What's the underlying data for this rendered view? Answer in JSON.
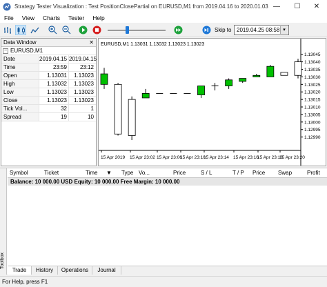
{
  "window": {
    "title": "Strategy Tester Visualization : Test PositionClosePartial on EURUSD,M1 from 2019.04.16 to 2020.01.03",
    "minimize": "—",
    "maximize": "☐",
    "close": "✕"
  },
  "menu": [
    "File",
    "View",
    "Charts",
    "Tester",
    "Help"
  ],
  "toolbar": {
    "skip_label": "Skip to",
    "skip_date": "2019.04.25 08:58",
    "dropdown_arrow": "▾",
    "speed_level": 0.3,
    "icons": [
      "bar-chart-icon",
      "candlestick-icon",
      "line-chart-icon",
      "zoom-in-icon",
      "zoom-out-icon",
      "play-icon",
      "stop-icon",
      "fast-forward-icon",
      "skip-forward-icon"
    ],
    "colors": {
      "play": "#1ea23c",
      "stop": "#d62222",
      "skip": "#1e78d7"
    }
  },
  "data_window": {
    "title": "Data Window",
    "close": "✕",
    "symbol": "EURUSD,M1",
    "expand": "−",
    "rows": [
      {
        "key": "Date",
        "v1": "2019.04.15",
        "v2": "2019.04.15"
      },
      {
        "key": "Time",
        "v1": "23:59",
        "v2": "23:12"
      },
      {
        "key": "Open",
        "v1": "1.13031",
        "v2": "1.13023"
      },
      {
        "key": "High",
        "v1": "1.13032",
        "v2": "1.13023"
      },
      {
        "key": "Low",
        "v1": "1.13023",
        "v2": "1.13023"
      },
      {
        "key": "Close",
        "v1": "1.13023",
        "v2": "1.13023"
      },
      {
        "key": "Tick Vol...",
        "v1": "32",
        "v2": "1"
      },
      {
        "key": "Spread",
        "v1": "19",
        "v2": "10"
      }
    ]
  },
  "chart": {
    "header": "EURUSD,M1  1.13031 1.13032 1.13023 1.13023",
    "colors": {
      "bull": "#00c000",
      "bear": "#ffffff",
      "wick": "#000000"
    },
    "y_ticks": [
      "1.13045",
      "1.13040",
      "1.13035",
      "1.13030",
      "1.13025",
      "1.13020",
      "1.13015",
      "1.13010",
      "1.13005",
      "1.13000",
      "1.12995",
      "1.12990"
    ],
    "x_ticks": [
      "15 Apr 2019",
      "15 Apr 23:02",
      "15 Apr 23:06",
      "15 Apr 23:10",
      "15 Apr 23:14",
      "15 Apr 23:16",
      "15 Apr 23:18",
      "15 Apr 23:20"
    ]
  },
  "chart_data": {
    "type": "candlestick",
    "title": "EURUSD,M1",
    "ylim": [
      1.12988,
      1.13049
    ],
    "candles": [
      {
        "open": 1.13025,
        "high": 1.13036,
        "low": 1.13022,
        "close": 1.13032
      },
      {
        "open": 1.13025,
        "high": 1.13026,
        "low": 1.12991,
        "close": 1.12992
      },
      {
        "open": 1.13015,
        "high": 1.13017,
        "low": 1.12988,
        "close": 1.12991
      },
      {
        "open": 1.13016,
        "high": 1.13022,
        "low": 1.13016,
        "close": 1.13019
      },
      {
        "open": 1.13019,
        "high": 1.13019,
        "low": 1.13019,
        "close": 1.13019
      },
      {
        "open": 1.13019,
        "high": 1.13019,
        "low": 1.13019,
        "close": 1.13019
      },
      {
        "open": 1.13019,
        "high": 1.13019,
        "low": 1.13019,
        "close": 1.13019
      },
      {
        "open": 1.13018,
        "high": 1.13024,
        "low": 1.13016,
        "close": 1.13024
      },
      {
        "open": 1.13024,
        "high": 1.13026,
        "low": 1.13021,
        "close": 1.13024
      },
      {
        "open": 1.13024,
        "high": 1.13029,
        "low": 1.13022,
        "close": 1.13028
      },
      {
        "open": 1.13027,
        "high": 1.13029,
        "low": 1.13026,
        "close": 1.13029
      },
      {
        "open": 1.1303,
        "high": 1.13032,
        "low": 1.1303,
        "close": 1.13031
      },
      {
        "open": 1.1303,
        "high": 1.13038,
        "low": 1.1303,
        "close": 1.13037
      },
      {
        "open": 1.13033,
        "high": 1.13033,
        "low": 1.13031,
        "close": 1.13031
      },
      {
        "open": 1.1304,
        "high": 1.13042,
        "low": 1.13029,
        "close": 1.13031
      }
    ]
  },
  "toolbox": {
    "side_label": "Toolbox",
    "columns": [
      "Symbol",
      "Ticket",
      "Time",
      "Type",
      "Vo...",
      "Price",
      "S / L",
      "T / P",
      "Price",
      "Swap",
      "Profit"
    ],
    "sort_arrow": "▼",
    "balance_line": "Balance: 10 000.00 USD   Equity: 10 000.00   Free Margin: 10 000.00",
    "tabs": [
      "Trade",
      "History",
      "Operations",
      "Journal"
    ]
  },
  "status": "For Help, press F1"
}
